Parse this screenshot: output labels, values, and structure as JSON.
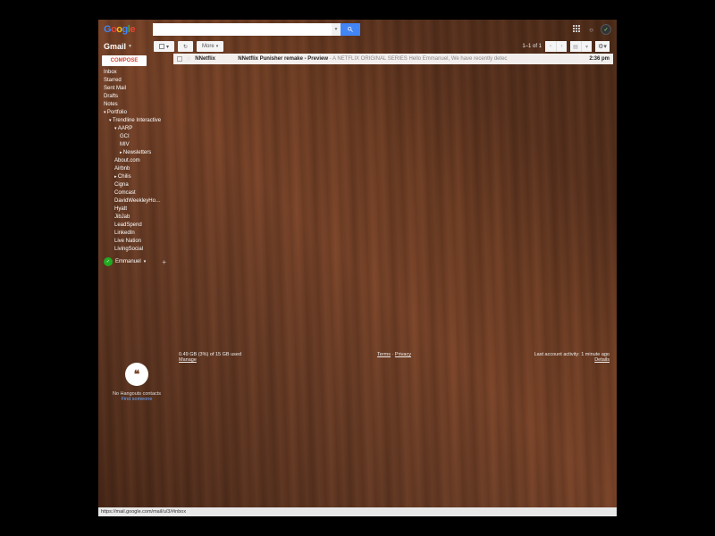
{
  "logo_letters": [
    "G",
    "o",
    "o",
    "g",
    "l",
    "e"
  ],
  "search": {
    "placeholder": ""
  },
  "gmail_label": "Gmail",
  "toolbar": {
    "refresh": "↻",
    "more": "More",
    "count": "1–1 of 1"
  },
  "compose": "COMPOSE",
  "folders": [
    {
      "t": "Inbox",
      "l": 0
    },
    {
      "t": "Starred",
      "l": 0
    },
    {
      "t": "Sent Mail",
      "l": 0
    },
    {
      "t": "Drafts",
      "l": 0
    },
    {
      "t": "Notes",
      "l": 0
    },
    {
      "t": "Portfolio",
      "l": 0,
      "ex": "d"
    },
    {
      "t": "Trendline Interactive",
      "l": 1,
      "ex": "d"
    },
    {
      "t": "AARP",
      "l": 2,
      "ex": "d"
    },
    {
      "t": "GCI",
      "l": 3
    },
    {
      "t": "MIV",
      "l": 3
    },
    {
      "t": "Newsletters",
      "l": 3,
      "ex": "r"
    },
    {
      "t": "About.com",
      "l": 2
    },
    {
      "t": "Airbnb",
      "l": 2
    },
    {
      "t": "Chilis",
      "l": 2,
      "ex": "r"
    },
    {
      "t": "Cigna",
      "l": 2
    },
    {
      "t": "Comcast",
      "l": 2
    },
    {
      "t": "DavidWeekleyHo…",
      "l": 2
    },
    {
      "t": "Hyatt",
      "l": 2
    },
    {
      "t": "JibJab",
      "l": 2
    },
    {
      "t": "LeadSpend",
      "l": 2
    },
    {
      "t": "LinkedIn",
      "l": 2
    },
    {
      "t": "Live Nation",
      "l": 2
    },
    {
      "t": "LivingSocial",
      "l": 2
    }
  ],
  "chat_user": "Emmanuel",
  "message": {
    "sender": "NNetflix",
    "subject": "NNetflix Punisher remake - Preview",
    "snippet": " - A NETFLIX ORIGINAL SERIES Hello Emmanuel, We have recently detec",
    "time": "2:36 pm"
  },
  "hangouts": {
    "line1": "No Hangouts contacts",
    "line2": "Find someone"
  },
  "footer": {
    "storage": "0.49 GB (3%) of 15 GB used",
    "manage": "Manage",
    "terms": "Terms",
    "privacy": "Privacy",
    "activity": "Last account activity: 1 minute ago",
    "details": "Details"
  },
  "status_url": "https://mail.google.com/mail/u/3/#inbox"
}
